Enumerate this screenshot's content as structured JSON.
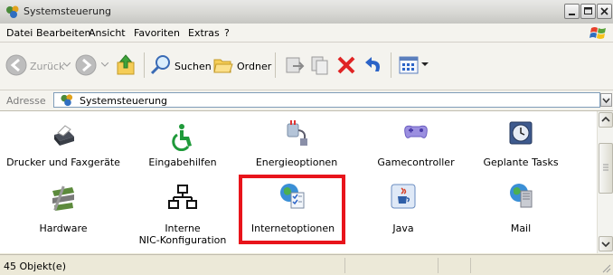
{
  "window": {
    "title": "Systemsteuerung"
  },
  "menu": [
    {
      "label": "Datei"
    },
    {
      "label": "Bearbeiten"
    },
    {
      "label": "Ansicht"
    },
    {
      "label": "Favoriten"
    },
    {
      "label": "Extras"
    },
    {
      "label": "?"
    }
  ],
  "toolbar": {
    "back_label": "Zurück",
    "search_label": "Suchen",
    "folders_label": "Ordner"
  },
  "address": {
    "label": "Adresse",
    "value": "Systemsteuerung"
  },
  "items": [
    {
      "label": "Drucker und Faxgeräte",
      "icon": "printer-icon"
    },
    {
      "label": "Eingabehilfen",
      "icon": "accessibility-icon"
    },
    {
      "label": "Energieoptionen",
      "icon": "power-plug-icon"
    },
    {
      "label": "Gamecontroller",
      "icon": "gamepad-icon"
    },
    {
      "label": "Geplante Tasks",
      "icon": "clock-icon"
    },
    {
      "label": "Hardware",
      "icon": "hardware-icon"
    },
    {
      "label": "Interne",
      "label2": "NIC-Konfiguration",
      "icon": "network-icon"
    },
    {
      "label": "Internetoptionen",
      "icon": "globe-checklist-icon"
    },
    {
      "label": "Java",
      "icon": "java-cup-icon"
    },
    {
      "label": "Mail",
      "icon": "mail-icon"
    }
  ],
  "highlighted_item": "Internetoptionen",
  "status": {
    "text": "45 Objekt(e)"
  },
  "colors": {
    "highlight": "#e8141b",
    "window_frame": "#ece9d8"
  }
}
